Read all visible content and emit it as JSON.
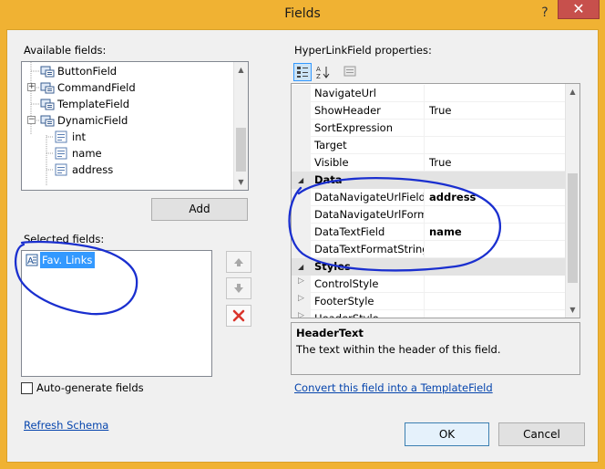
{
  "window": {
    "title": "Fields",
    "help_glyph": "?",
    "close_glyph": "✕"
  },
  "available": {
    "label": "Available fields:",
    "items": [
      {
        "label": "ButtonField",
        "icon": "button-field-icon"
      },
      {
        "label": "CommandField",
        "icon": "command-field-icon",
        "expander": "+"
      },
      {
        "label": "TemplateField",
        "icon": "template-field-icon"
      },
      {
        "label": "DynamicField",
        "icon": "dynamic-field-icon",
        "expander": "−"
      },
      {
        "label": "int",
        "icon": "field-icon"
      },
      {
        "label": "name",
        "icon": "field-icon"
      },
      {
        "label": "address",
        "icon": "field-icon"
      }
    ],
    "add_label": "Add"
  },
  "selected": {
    "label": "Selected fields:",
    "items": [
      {
        "label": "Fav. Links",
        "icon": "hyperlink-field-icon"
      }
    ]
  },
  "properties": {
    "label": "HyperLinkField properties:",
    "rows": [
      {
        "type": "prop",
        "name": "NavigateUrl",
        "value": ""
      },
      {
        "type": "prop",
        "name": "ShowHeader",
        "value": "True"
      },
      {
        "type": "prop",
        "name": "SortExpression",
        "value": ""
      },
      {
        "type": "prop",
        "name": "Target",
        "value": ""
      },
      {
        "type": "prop",
        "name": "Visible",
        "value": "True"
      },
      {
        "type": "cat",
        "name": "Data",
        "expander": "◢"
      },
      {
        "type": "prop",
        "name": "DataNavigateUrlFields",
        "value": "address",
        "bold": true
      },
      {
        "type": "prop",
        "name": "DataNavigateUrlFormatString",
        "value": ""
      },
      {
        "type": "prop",
        "name": "DataTextField",
        "value": "name",
        "bold": true
      },
      {
        "type": "prop",
        "name": "DataTextFormatString",
        "value": ""
      },
      {
        "type": "cat",
        "name": "Styles",
        "expander": "◢"
      },
      {
        "type": "prop",
        "name": "ControlStyle",
        "value": "",
        "expander": "▷"
      },
      {
        "type": "prop",
        "name": "FooterStyle",
        "value": "",
        "expander": "▷"
      },
      {
        "type": "prop",
        "name": "HeaderStyle",
        "value": "",
        "expander": "▷"
      }
    ],
    "description_title": "HeaderText",
    "description_text": "The text within the header of this field.",
    "convert_link": "Convert this field into a TemplateField"
  },
  "auto_generate_label": "Auto-generate fields",
  "refresh_schema": "Refresh Schema",
  "ok_label": "OK",
  "cancel_label": "Cancel",
  "colors": {
    "titlebar": "#f0b233",
    "annotation_ink": "#1a2fcf",
    "selection": "#3399ff",
    "link": "#0645ad"
  }
}
